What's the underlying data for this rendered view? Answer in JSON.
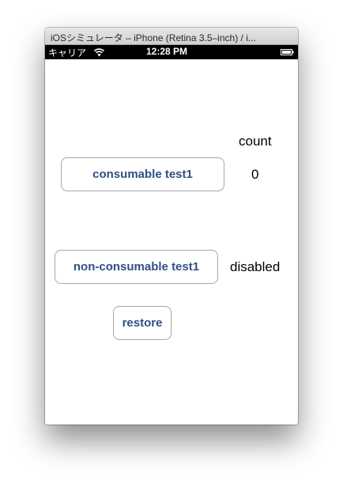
{
  "window": {
    "title": "iOSシミュレータ – iPhone (Retina 3.5–inch) / i..."
  },
  "status_bar": {
    "carrier": "キャリア",
    "time": "12:28 PM",
    "wifi_icon": "wifi-icon",
    "battery_icon": "battery-icon"
  },
  "screen": {
    "count_label": "count",
    "count_value": "0",
    "consumable_button": "consumable test1",
    "non_consumable_button": "non-consumable test1",
    "status_label": "disabled",
    "restore_button": "restore"
  },
  "colors": {
    "button_text": "#324f85",
    "status_bar_bg": "#000000"
  }
}
